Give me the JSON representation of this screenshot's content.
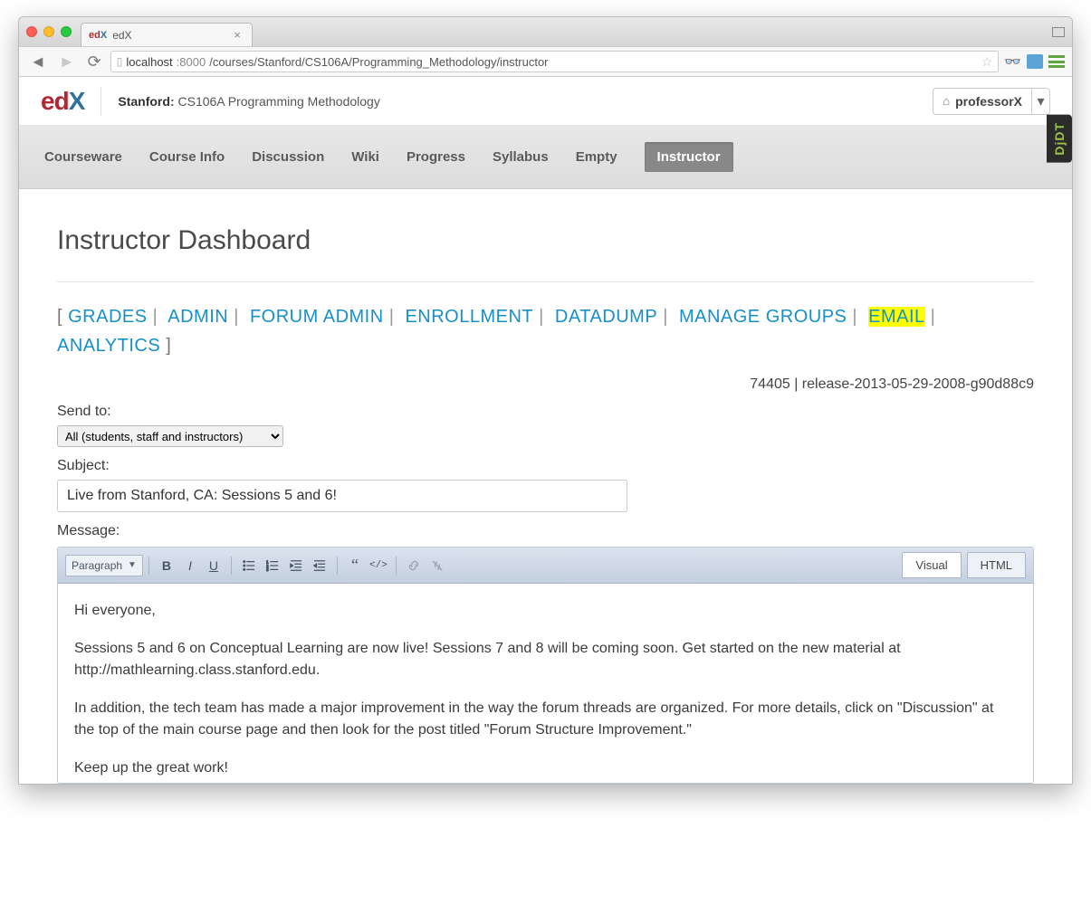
{
  "browser": {
    "tab_title": "edX",
    "url_host": "localhost",
    "url_port": ":8000",
    "url_path": "/courses/Stanford/CS106A/Programming_Methodology/instructor"
  },
  "header": {
    "logo": {
      "ed": "ed",
      "x": "X"
    },
    "org": "Stanford",
    "course_name": "CS106A Programming Methodology",
    "username": "professorX"
  },
  "djdt": "DjDT",
  "course_nav": {
    "items": [
      {
        "label": "Courseware"
      },
      {
        "label": "Course Info"
      },
      {
        "label": "Discussion"
      },
      {
        "label": "Wiki"
      },
      {
        "label": "Progress"
      },
      {
        "label": "Syllabus"
      },
      {
        "label": "Empty"
      },
      {
        "label": "Instructor"
      }
    ]
  },
  "page_title": "Instructor Dashboard",
  "sublinks": {
    "open_bracket": "[ ",
    "close_bracket": " ]",
    "items": [
      {
        "label": "GRADES"
      },
      {
        "label": "ADMIN"
      },
      {
        "label": "FORUM ADMIN"
      },
      {
        "label": "ENROLLMENT"
      },
      {
        "label": "DATADUMP"
      },
      {
        "label": "MANAGE GROUPS"
      },
      {
        "label": "EMAIL"
      },
      {
        "label": "ANALYTICS"
      }
    ]
  },
  "release": "74405 | release-2013-05-29-2008-g90d88c9",
  "form": {
    "sendto_label": "Send to:",
    "sendto_value": "All (students, staff and instructors)",
    "subject_label": "Subject:",
    "subject_value": "Live from Stanford, CA: Sessions 5 and 6!",
    "message_label": "Message:"
  },
  "editor": {
    "paragraph": "Paragraph",
    "tabs": {
      "visual": "Visual",
      "html": "HTML"
    },
    "body": {
      "p1": "Hi everyone,",
      "p2": "Sessions 5 and 6 on Conceptual Learning are now live!  Sessions 7 and 8 will be coming soon.  Get started on the new material at http://mathlearning.class.stanford.edu.",
      "p3": "In addition, the tech team has made a major improvement in the way the forum threads are organized. For more details, click on \"Discussion\" at the top of the main course page and then look for the post titled \"Forum Structure Improvement.\"",
      "p4": "Keep up the great work!"
    }
  }
}
